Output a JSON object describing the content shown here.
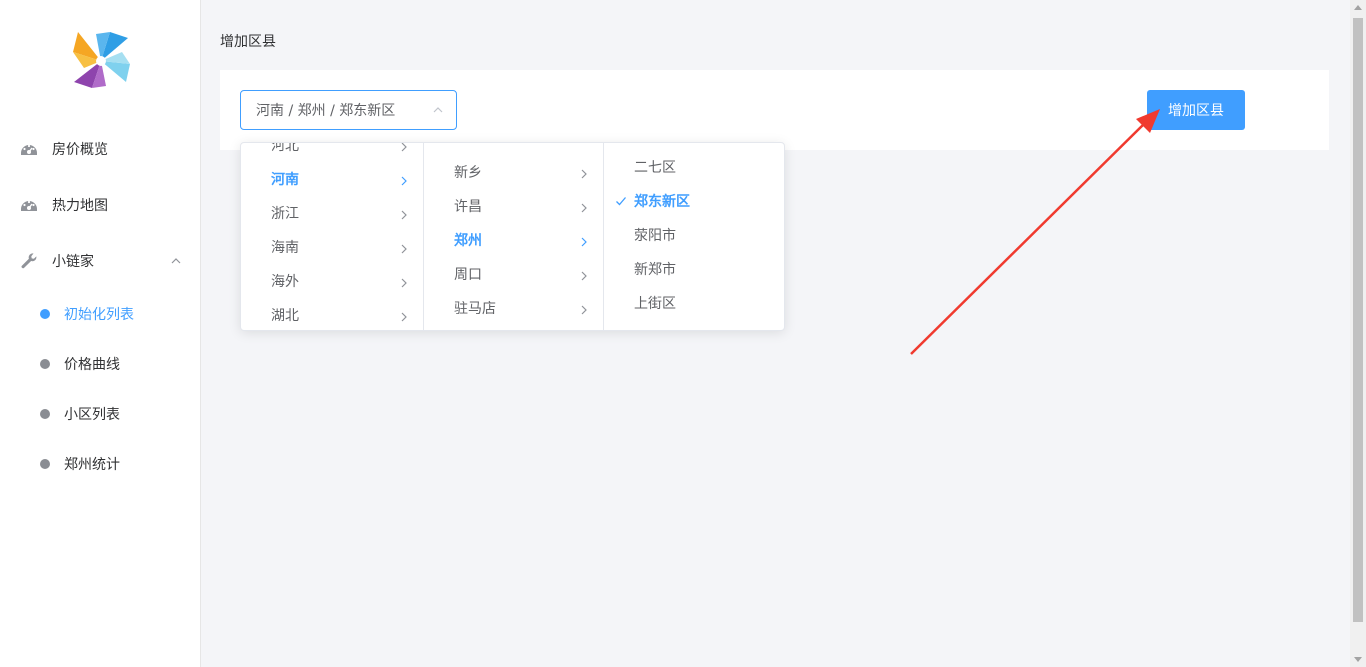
{
  "sidebar": {
    "menu": [
      {
        "label": "房价概览",
        "icon": "dashboard-icon"
      },
      {
        "label": "热力地图",
        "icon": "dashboard-icon"
      },
      {
        "label": "小链家",
        "icon": "wrench-icon",
        "expanded": true
      }
    ],
    "submenu": [
      {
        "label": "初始化列表",
        "active": true
      },
      {
        "label": "价格曲线",
        "active": false
      },
      {
        "label": "小区列表",
        "active": false
      },
      {
        "label": "郑州统计",
        "active": false
      }
    ]
  },
  "main": {
    "title": "增加区县",
    "cascader_value": "河南 / 郑州 / 郑东新区",
    "add_button": "增加区县"
  },
  "dropdown": {
    "provinces": [
      "河北",
      "河南",
      "浙江",
      "海南",
      "海外",
      "湖北"
    ],
    "province_selected": "河南",
    "cities": [
      "新乡",
      "许昌",
      "郑州",
      "周口",
      "驻马店"
    ],
    "city_selected": "郑州",
    "districts": [
      "二七区",
      "郑东新区",
      "荥阳市",
      "新郑市",
      "上街区"
    ],
    "district_selected": "郑东新区"
  },
  "colors": {
    "accent": "#409eff",
    "annotation_arrow": "#f03a2f"
  }
}
